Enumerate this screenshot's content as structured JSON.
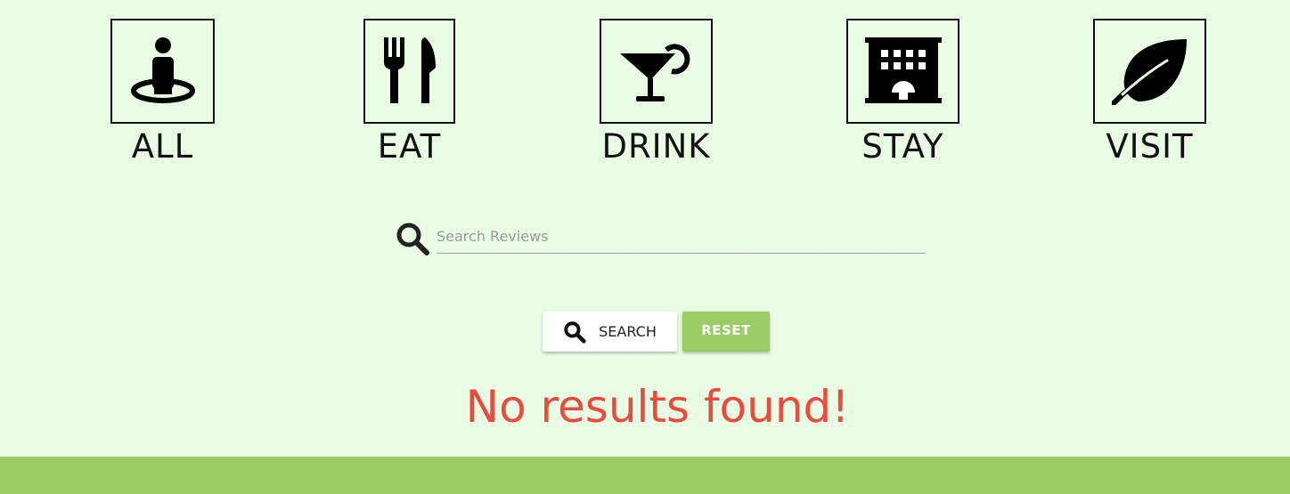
{
  "categories": [
    {
      "label": "ALL",
      "icon": "person-pin-icon"
    },
    {
      "label": "EAT",
      "icon": "fork-knife-icon"
    },
    {
      "label": "DRINK",
      "icon": "cocktail-icon"
    },
    {
      "label": "STAY",
      "icon": "hotel-icon"
    },
    {
      "label": "VISIT",
      "icon": "leaf-icon"
    }
  ],
  "search": {
    "placeholder": "Search Reviews",
    "value": "",
    "icon": "search-icon"
  },
  "buttons": {
    "search_label": "SEARCH",
    "reset_label": "RESET"
  },
  "message": "No results found!",
  "colors": {
    "background": "#e8fde4",
    "accent": "#9ccc65",
    "error": "#e94c3d"
  }
}
